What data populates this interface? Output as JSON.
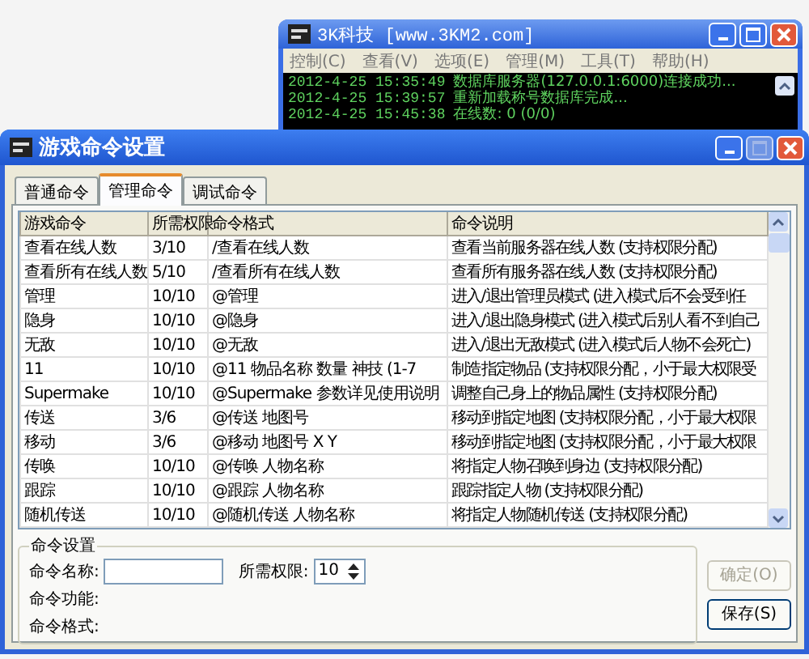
{
  "console": {
    "title": "3K科技 [www.3KM2.com]",
    "menu": [
      "控制(C)",
      "查看(V)",
      "选项(E)",
      "管理(M)",
      "工具(T)",
      "帮助(H)"
    ],
    "log": [
      {
        "time": "2012-4-25 15:35:49",
        "message": "数据库服务器(127.0.0.1:6000)连接成功..."
      },
      {
        "time": "2012-4-25 15:39:57",
        "message": "重新加载称号数据库完成..."
      },
      {
        "time": "2012-4-25 15:45:38",
        "message": "在线数: 0 (0/0)"
      }
    ]
  },
  "dialog": {
    "title": "游戏命令设置",
    "tabs": [
      {
        "label": "普通命令",
        "selected": false
      },
      {
        "label": "管理命令",
        "selected": true
      },
      {
        "label": "调试命令",
        "selected": false
      }
    ],
    "table": {
      "columns": [
        "游戏命令",
        "所需权限",
        "命令格式",
        "命令说明"
      ],
      "rows": [
        [
          "查看在线人数",
          "3/10",
          "/查看在线人数",
          "查看当前服务器在线人数 (支持权限分配)"
        ],
        [
          "查看所有在线人数",
          "5/10",
          "/查看所有在线人数",
          "查看所有服务器在线人数 (支持权限分配)"
        ],
        [
          "管理",
          "10/10",
          "@管理",
          "进入/退出管理员模式 (进入模式后不会受到任"
        ],
        [
          "隐身",
          "10/10",
          "@隐身",
          "进入/退出隐身模式 (进入模式后别人看不到自己"
        ],
        [
          "无敌",
          "10/10",
          "@无敌",
          "进入/退出无敌模式 (进入模式后人物不会死亡)"
        ],
        [
          "11",
          "10/10",
          "@11 物品名称 数量 神技 (1-7",
          "制造指定物品 (支持权限分配，小于最大权限受"
        ],
        [
          "Supermake",
          "10/10",
          "@Supermake 参数详见使用说明",
          "调整自己身上的物品属性 (支持权限分配)"
        ],
        [
          "传送",
          "3/6",
          "@传送 地图号",
          "移动到指定地图 (支持权限分配，小于最大权限"
        ],
        [
          "移动",
          "3/6",
          "@移动 地图号 X Y",
          "移动到指定地图 (支持权限分配，小于最大权限"
        ],
        [
          "传唤",
          "10/10",
          "@传唤 人物名称",
          "将指定人物召唤到身边 (支持权限分配)"
        ],
        [
          "跟踪",
          "10/10",
          "@跟踪 人物名称",
          "跟踪指定人物 (支持权限分配)"
        ],
        [
          "随机传送",
          "10/10",
          "@随机传送 人物名称",
          "将指定人物随机传送 (支持权限分配)"
        ]
      ]
    },
    "settings": {
      "title": "命令设置",
      "name_label": "命令名称:",
      "permission_label": "所需权限:",
      "permission_value": "10",
      "function_label": "命令功能:",
      "format_label": "命令格式:"
    },
    "buttons": [
      {
        "label": "确定(O)",
        "disabled": true
      },
      {
        "label": "保存(S)",
        "disabled": false
      }
    ]
  }
}
